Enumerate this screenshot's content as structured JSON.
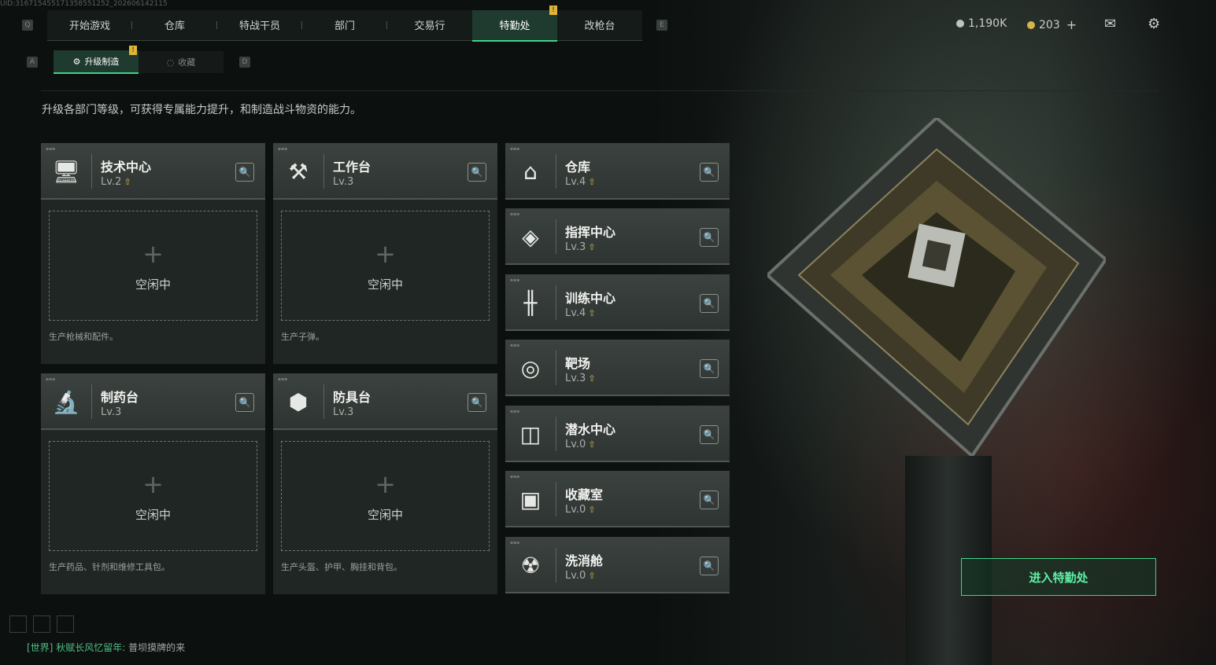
{
  "top_id_text": "UID:316715455171358551252_202606142115",
  "nav": {
    "left_key": "Q",
    "right_key": "E",
    "tabs": [
      {
        "label": "开始游戏"
      },
      {
        "label": "仓库"
      },
      {
        "label": "特战干员"
      },
      {
        "label": "部门"
      },
      {
        "label": "交易行"
      },
      {
        "label": "特勤处",
        "active": true,
        "badge": "!"
      },
      {
        "label": "改枪台"
      }
    ]
  },
  "currency": {
    "silver": "1,190K",
    "gold": "203",
    "add": "+"
  },
  "subnav": {
    "left_key": "A",
    "right_key": "D",
    "tabs": [
      {
        "label": "升级制造",
        "active": true,
        "badge": "!"
      },
      {
        "label": "收藏"
      }
    ]
  },
  "description": "升级各部门等级，可获得专属能力提升，和制造战斗物资的能力。",
  "production_departments": [
    {
      "name": "技术中心",
      "level": "Lv.2",
      "upgradable": true,
      "icon": "monitor-icon",
      "slot_status": "空闲中",
      "slot_desc": "生产枪械和配件。"
    },
    {
      "name": "工作台",
      "level": "Lv.3",
      "upgradable": false,
      "icon": "tools-icon",
      "slot_status": "空闲中",
      "slot_desc": "生产子弹。"
    },
    {
      "name": "制药台",
      "level": "Lv.3",
      "upgradable": false,
      "icon": "microscope-icon",
      "slot_status": "空闲中",
      "slot_desc": "生产药品、针剂和维修工具包。"
    },
    {
      "name": "防具台",
      "level": "Lv.3",
      "upgradable": false,
      "icon": "blocks-icon",
      "slot_status": "空闲中",
      "slot_desc": "生产头盔、护甲、胸挂和背包。"
    }
  ],
  "other_departments": [
    {
      "name": "仓库",
      "level": "Lv.4",
      "upgradable": true,
      "icon": "storage-icon"
    },
    {
      "name": "指挥中心",
      "level": "Lv.3",
      "upgradable": true,
      "icon": "command-icon"
    },
    {
      "name": "训练中心",
      "level": "Lv.4",
      "upgradable": true,
      "icon": "dumbbell-icon"
    },
    {
      "name": "靶场",
      "level": "Lv.3",
      "upgradable": true,
      "icon": "target-icon"
    },
    {
      "name": "潜水中心",
      "level": "Lv.0",
      "upgradable": true,
      "icon": "diving-mask-icon"
    },
    {
      "name": "收藏室",
      "level": "Lv.0",
      "upgradable": true,
      "icon": "collection-icon"
    },
    {
      "name": "洗消舱",
      "level": "Lv.0",
      "upgradable": true,
      "icon": "decontamination-icon"
    }
  ],
  "enter_button": "进入特勤处",
  "chat": {
    "channel": "[世界]",
    "sender": "秋赋长风忆留年:",
    "message": "普坝摸牌的来"
  },
  "colors": {
    "accent": "#3fd48b",
    "upgrade_arrow": "#d8b44a",
    "badge": "#e0b437"
  }
}
